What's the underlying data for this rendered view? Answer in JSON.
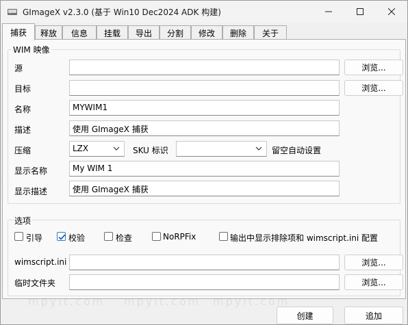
{
  "window": {
    "title": "GImageX v2.3.0 (基于 Win10 Dec2024 ADK 构建)"
  },
  "tabs": [
    {
      "label": "捕获",
      "active": true
    },
    {
      "label": "释放"
    },
    {
      "label": "信息"
    },
    {
      "label": "挂载"
    },
    {
      "label": "导出"
    },
    {
      "label": "分割"
    },
    {
      "label": "修改"
    },
    {
      "label": "删除"
    },
    {
      "label": "关于"
    }
  ],
  "wim_group": {
    "title": "WIM 映像",
    "source_label": "源",
    "source_value": "",
    "target_label": "目标",
    "target_value": "",
    "name_label": "名称",
    "name_value": "MYWIM1",
    "desc_label": "描述",
    "desc_value": "使用 GImageX 捕获",
    "compress_label": "压缩",
    "compress_value": "LZX",
    "sku_label": "SKU 标识",
    "sku_value": "",
    "sku_note": "留空自动设置",
    "display_name_label": "显示名称",
    "display_name_value": "My WIM 1",
    "display_desc_label": "显示描述",
    "display_desc_value": "使用 GImageX 捕获",
    "browse_label": "浏览..."
  },
  "options_group": {
    "title": "选项",
    "checkboxes": [
      {
        "label": "引导",
        "checked": false
      },
      {
        "label": "校验",
        "checked": true
      },
      {
        "label": "检查",
        "checked": false
      },
      {
        "label": "NoRPFix",
        "checked": false
      },
      {
        "label": "输出中显示排除项和 wimscript.ini 配置",
        "checked": false
      }
    ],
    "wimscript_label": "wimscript.ini",
    "wimscript_value": "",
    "temp_label": "临时文件夹",
    "temp_value": "",
    "browse_label": "浏览..."
  },
  "actions": {
    "create_label": "创建",
    "append_label": "追加"
  },
  "watermark_text": "mpyit.com",
  "colors": {
    "accent": "#1a63c4",
    "checkbox_border": "#3c75b8"
  }
}
